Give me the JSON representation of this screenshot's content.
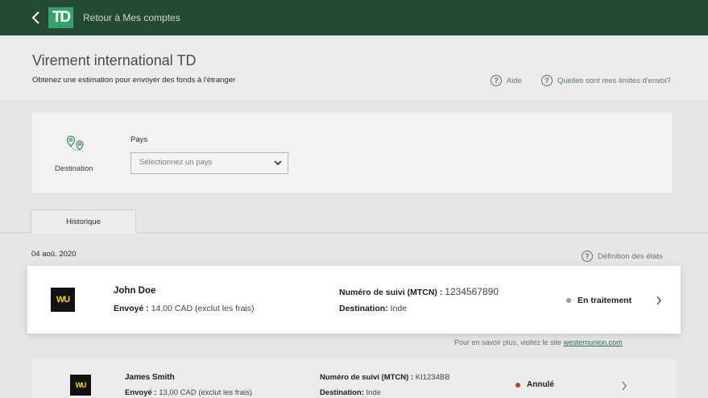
{
  "header": {
    "back_label": "Retour à Mes comptes",
    "logo_text": "TD",
    "icons": {
      "back": "chevron-left-icon",
      "logo": "td-logo"
    }
  },
  "page": {
    "title": "Virement international TD",
    "subtitle": "Obtenez une estimation pour envoyer des fonds à l'étranger",
    "help_links": [
      {
        "label": "Aide",
        "icon": "help-circle-icon"
      },
      {
        "label": "Quelles sont mes limites d'envoi?",
        "icon": "help-circle-icon"
      }
    ]
  },
  "destination": {
    "label": "Destination",
    "icon": "map-pins-icon",
    "country_label": "Pays",
    "country_placeholder": "Sélectionnez un pays"
  },
  "tabs": [
    {
      "label": "Historique",
      "active": true
    }
  ],
  "history": {
    "date": "04 aoû. 2020",
    "states_link": "Définition des états",
    "learn_more_text": "Pour en savoir plus, visitez le site",
    "learn_more_link": "westernunion.com",
    "transfers": [
      {
        "name": "John Doe",
        "sent_label": "Envoyé :",
        "sent_value": "14,00 CAD (exclut les frais)",
        "mtcn_label": "Numéro de suivi (MTCN) :",
        "mtcn_value": "1234567890",
        "destination_label": "Destination:",
        "destination_value": "Inde",
        "status": "En traitement",
        "status_color": "#9a9a9a",
        "logo_text": "WU"
      },
      {
        "name": "James Smith",
        "sent_label": "Envoyé :",
        "sent_value": "13,00 CAD (exclut les frais)",
        "mtcn_label": "Numéro de suivi (MTCN) :",
        "mtcn_value": "KI1234BB",
        "destination_label": "Destination:",
        "destination_value": "Inde",
        "status": "Annulé",
        "status_color": "#b8432f",
        "logo_text": "WU"
      }
    ]
  },
  "colors": {
    "header_bg": "#254a33",
    "brand_green": "#34a36a",
    "link_green": "#5e7d68"
  }
}
